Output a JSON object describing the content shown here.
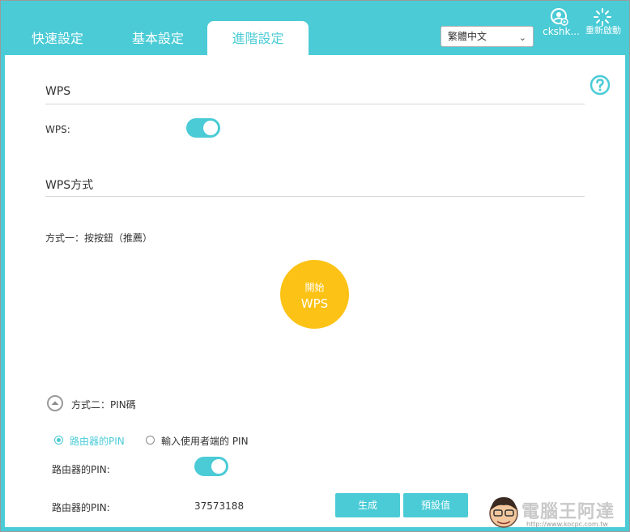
{
  "tabs": [
    {
      "label": "快速設定",
      "active": false
    },
    {
      "label": "基本設定",
      "active": false
    },
    {
      "label": "進階設定",
      "active": true
    }
  ],
  "language": {
    "selected": "繁體中文"
  },
  "header": {
    "user_label": "ckshk...",
    "reboot_label": "重新啟動",
    "user_icon": "user-icon",
    "reboot_icon": "reboot-icon"
  },
  "colors": {
    "accent": "#4acbd6",
    "wps_button": "#fcc215"
  },
  "wps_section": {
    "title": "WPS",
    "toggle_label": "WPS:",
    "toggle_on": true
  },
  "method_section": {
    "title": "WPS方式",
    "method1_label": "方式一：按按鈕（推薦）",
    "wps_button_line1": "開始",
    "wps_button_line2": "WPS",
    "method2_label": "方式二：PIN碼",
    "radio_router_pin": "路由器的PIN",
    "radio_client_pin": "輸入使用者端的 PIN",
    "router_pin_toggle_label": "路由器的PIN:",
    "router_pin_toggle_on": true,
    "router_pin_label": "路由器的PIN:",
    "router_pin_value": "37573188",
    "generate_button": "生成",
    "default_button": "預設值"
  },
  "watermark": {
    "text": "電腦王阿達",
    "url": "http://www.kocpc.com.tw"
  }
}
